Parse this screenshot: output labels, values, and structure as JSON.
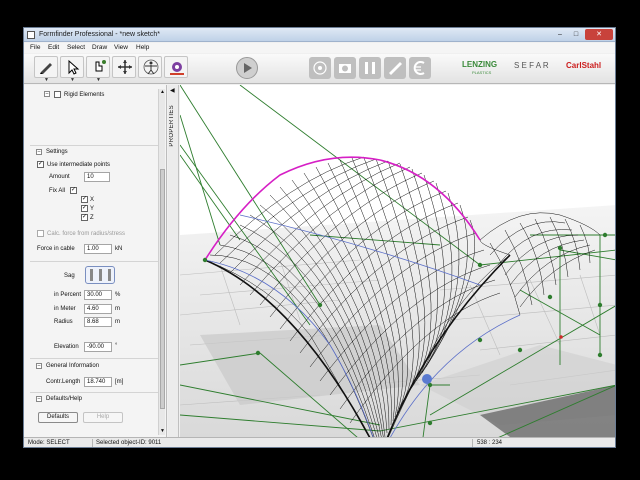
{
  "window": {
    "title": "Formfinder Professional - *new sketch*"
  },
  "controls": {
    "minimize": "–",
    "maximize": "□",
    "close": "✕"
  },
  "menu": [
    "File",
    "Edit",
    "Select",
    "Draw",
    "View",
    "Help"
  ],
  "toolbar": {
    "icons": [
      "pencil-icon",
      "pointer-icon",
      "hand-pointer-icon",
      "move-icon",
      "vitruvian-man-icon",
      "gear-icon",
      "play-icon",
      "network-icon",
      "camera-icon",
      "tools-icon",
      "ruler-icon",
      "euro-icon"
    ],
    "logos": {
      "lenzing": "LENZING",
      "lenzing_sub": "PLASTICS",
      "sefar": "S E F A R",
      "carl": "CarlStahl"
    }
  },
  "panel": {
    "tree_item": "Rigid Elements",
    "settings": {
      "header": "Settings",
      "use_intermediate": "Use intermediate points",
      "amount_label": "Amount",
      "amount_value": "10",
      "fix_all_label": "Fix All",
      "axes": [
        "X",
        "Y",
        "Z"
      ],
      "calc_label": "Calc. force from radius/stress",
      "force_label": "Force in cable",
      "force_value": "1.00",
      "force_unit": "kN",
      "sag_label": "Sag",
      "percent_label": "in Percent",
      "percent_value": "30.00",
      "percent_unit": "%",
      "meter_label": "in Meter",
      "meter_value": "4.60",
      "meter_unit": "m",
      "radius_label": "Radius",
      "radius_value": "8.68",
      "radius_unit": "m",
      "elevation_label": "Elevation",
      "elevation_value": "-90.00",
      "elevation_unit": "°"
    },
    "general": {
      "header": "General Information",
      "length_label": "Contr.Length",
      "length_value": "18.740",
      "length_unit": "[m]"
    },
    "defaults": {
      "header": "Defaults/Help",
      "defaults_button": "Defaults",
      "help_button": "Help"
    }
  },
  "sidebar_tab": "PROPERTIES",
  "status": {
    "mode": "Mode: SELECT",
    "selected": "Selected object-ID: 9011",
    "coords": "538 : 234"
  }
}
